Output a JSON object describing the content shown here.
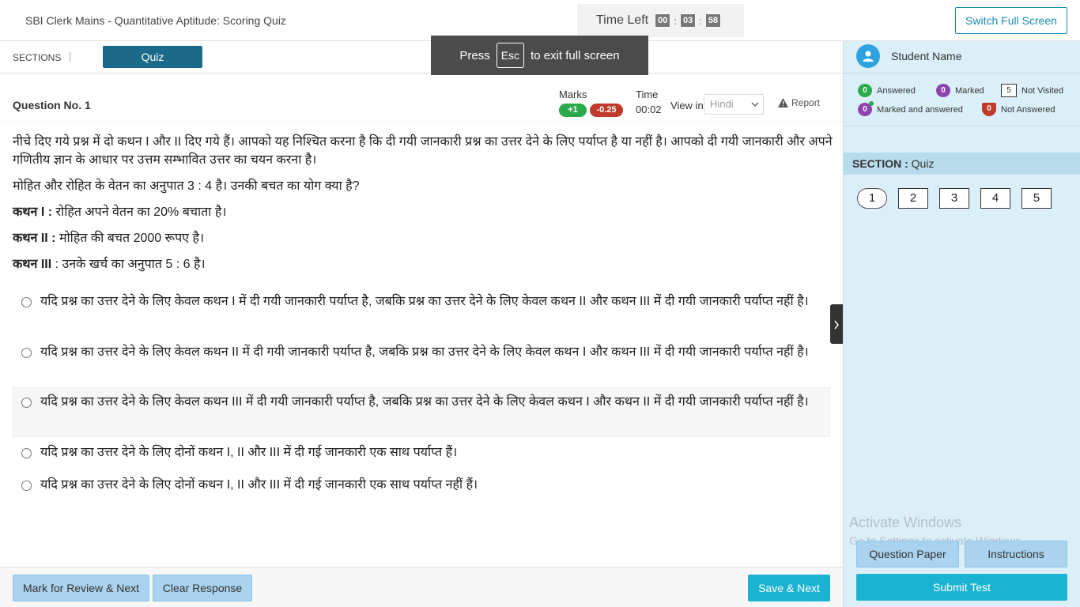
{
  "header": {
    "title": "SBI Clerk Mains - Quantitative Aptitude: Scoring Quiz",
    "timer_label": "Time Left",
    "timer": {
      "hh": "00",
      "mm": "03",
      "ss": "58"
    },
    "switch_label": "Switch Full Screen"
  },
  "sections": {
    "label": "SECTIONS",
    "active_tab": "Quiz"
  },
  "toast": {
    "press": "Press",
    "key": "Esc",
    "rest": "to exit full screen"
  },
  "question": {
    "number_label": "Question No. 1",
    "marks_label": "Marks",
    "marks_pos": "+1",
    "marks_neg": "-0.25",
    "time_label": "Time",
    "time_value": "00:02",
    "view_in_label": "View in",
    "language": "Hindi",
    "report_label": "Report",
    "instruction": "नीचे दिए गये प्रश्न में दो कथन I और II दिए गये हैं। आपको यह निश्चित करना है कि दी गयी जानकारी प्रश्न का उत्तर देने के लिए पर्याप्त है या नहीं है। आपको दी गयी जानकारी और अपने गणितीय ज्ञान के आधार पर उत्तम सम्भावित उत्तर का चयन करना है।",
    "stem": "मोहित और रोहित के वेतन का अनुपात 3 : 4 है। उनकी बचत का योग क्या है?",
    "statements": [
      {
        "label": "कथन I :",
        "text": " रोहित अपने वेतन का 20% बचाता है।"
      },
      {
        "label": "कथन II :",
        "text": " मोहित की बचत 2000 रूपए है।"
      },
      {
        "label": "कथन III",
        "text": " : उनके खर्च का अनुपात 5 : 6 है।"
      }
    ],
    "options": [
      "यदि प्रश्न का उत्तर देने के लिए केवल कथन I में दी गयी जानकारी पर्याप्त है, जबकि प्रश्न का उत्तर देने के लिए केवल कथन II और कथन III में दी गयी जानकारी पर्याप्त नहीं है।",
      "यदि प्रश्न का उत्तर देने के लिए केवल कथन II में दी गयी जानकारी पर्याप्त है, जबकि प्रश्न का उत्तर देने के लिए केवल कथन I और कथन III में दी गयी जानकारी पर्याप्त नहीं है।",
      "यदि प्रश्न का उत्तर देने के लिए केवल कथन III में दी गयी जानकारी पर्याप्त है, जबकि प्रश्न का उत्तर देने के लिए केवल कथन I और कथन II में दी गयी जानकारी पर्याप्त नहीं है।",
      "यदि प्रश्न का उत्तर देने के लिए दोनों कथन I, II और III में दी गई जानकारी एक साथ पर्याप्त हैं।",
      "यदि प्रश्न का उत्तर देने के लिए दोनों कथन I, II और III में दी गई जानकारी एक साथ पर्याप्त नहीं हैं।"
    ]
  },
  "footer": {
    "mark_review": "Mark for Review & Next",
    "clear": "Clear Response",
    "save_next": "Save & Next"
  },
  "sidebar": {
    "student_name": "Student Name",
    "legend": {
      "answered": {
        "count": "0",
        "label": "Answered"
      },
      "marked": {
        "count": "0",
        "label": "Marked"
      },
      "not_visited": {
        "count": "5",
        "label": "Not Visited"
      },
      "marked_answered": {
        "count": "0",
        "label": "Marked and answered"
      },
      "not_answered": {
        "count": "0",
        "label": "Not Answered"
      }
    },
    "section_prefix": "SECTION :",
    "section_name": "Quiz",
    "palette": [
      "1",
      "2",
      "3",
      "4",
      "5"
    ],
    "watermark_title": "Activate Windows",
    "watermark_sub": "Go to Settings to activate Windows.",
    "question_paper": "Question Paper",
    "instructions": "Instructions",
    "submit": "Submit Test"
  },
  "colors": {
    "accent": "#1ab3d1",
    "tab": "#1c6a8a",
    "answered": "#2aaa4a",
    "marked": "#8e44ad",
    "not_answered": "#c0392b",
    "sidebar_bg": "#dbeff9"
  }
}
